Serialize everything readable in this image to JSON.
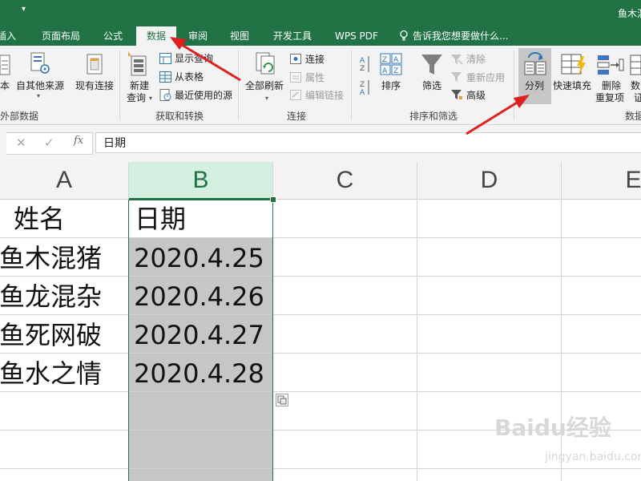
{
  "app": {
    "title": "鱼木混",
    "accent_color": "#217346",
    "qa_menu_glyph": "▾"
  },
  "tabs": [
    {
      "label": "插入",
      "active": false
    },
    {
      "label": "页面布局",
      "active": false
    },
    {
      "label": "公式",
      "active": false
    },
    {
      "label": "数据",
      "active": true
    },
    {
      "label": "审阅",
      "active": false
    },
    {
      "label": "视图",
      "active": false
    },
    {
      "label": "开发工具",
      "active": false
    },
    {
      "label": "WPS PDF",
      "active": false
    }
  ],
  "tell_me": {
    "placeholder": "告诉我您想要做什么...",
    "icon": "lightbulb-icon"
  },
  "ribbon": {
    "get_external": {
      "from_text_label": "本",
      "other_sources_label": "自其他来源",
      "existing_conn_label": "现有连接",
      "group_label": "外部数据"
    },
    "get_transform": {
      "new_query_label_1": "新建",
      "new_query_label_2": "查询",
      "show_queries_label": "显示查询",
      "from_table_label": "从表格",
      "recent_sources_label": "最近使用的源",
      "group_label": "获取和转换"
    },
    "connections": {
      "refresh_all_label": "全部刷新",
      "connections_label": "连接",
      "properties_label": "属性",
      "edit_links_label": "编辑链接",
      "group_label": "连接"
    },
    "sort_filter": {
      "sort_label": "排序",
      "filter_label": "筛选",
      "clear_label": "清除",
      "reapply_label": "重新应用",
      "advanced_label": "高级",
      "group_label": "排序和筛选"
    },
    "data_tools": {
      "text_to_columns_label": "分列",
      "flash_fill_label": "快速填充",
      "remove_duplicates_label_1": "删除",
      "remove_duplicates_label_2": "重复项",
      "validation_label_1": "数",
      "validation_label_2": "证",
      "group_label": "数据"
    }
  },
  "formula_bar": {
    "cancel_glyph": "✕",
    "enter_glyph": "✓",
    "fx_label": "fx",
    "value": "日期"
  },
  "columns": [
    "A",
    "B",
    "C",
    "D",
    "E"
  ],
  "selected_column": "B",
  "rows": [
    {
      "name": "姓名",
      "date": "日期"
    },
    {
      "name": "鱼木混猪",
      "date": "2020.4.25"
    },
    {
      "name": "鱼龙混杂",
      "date": "2020.4.26"
    },
    {
      "name": "鱼死网破",
      "date": "2020.4.27"
    },
    {
      "name": "鱼水之情",
      "date": "2020.4.28"
    }
  ],
  "watermark": {
    "logo": "Baidu经验",
    "url": "jingyan.baidu.com"
  },
  "annotation_color": "#e02020"
}
